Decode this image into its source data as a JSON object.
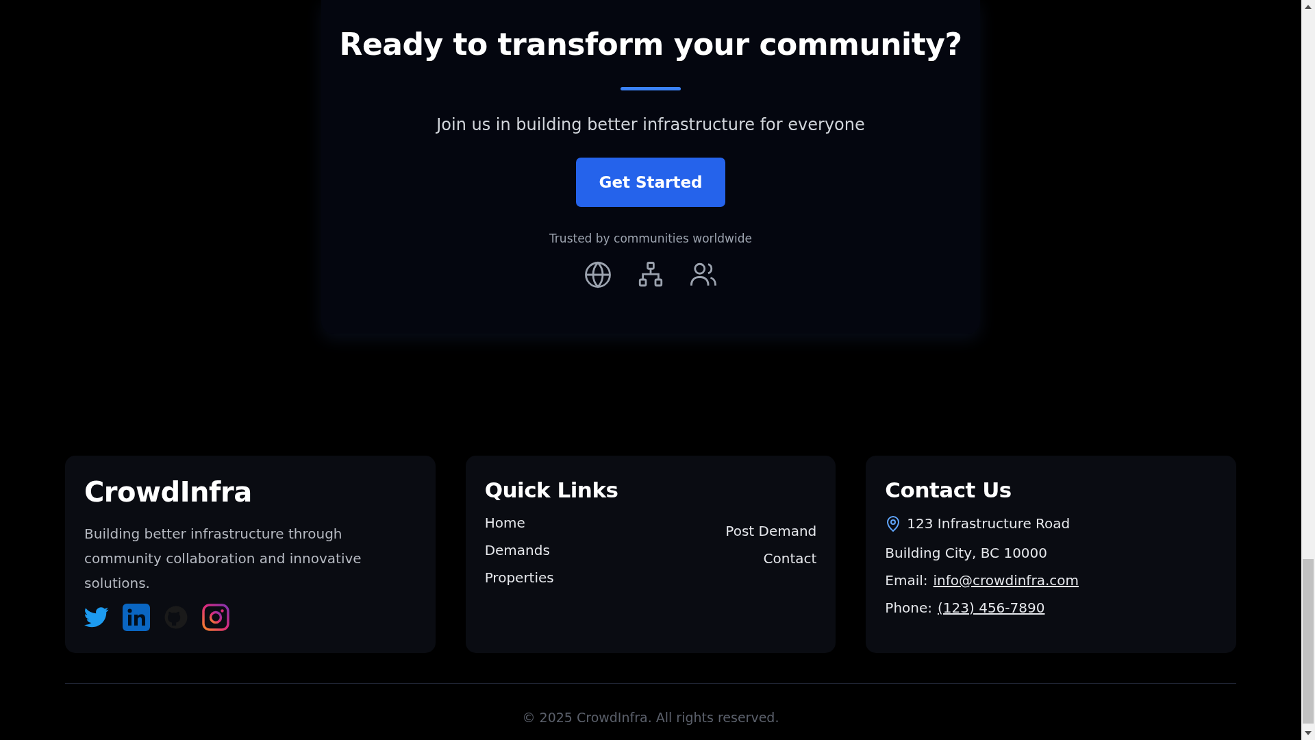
{
  "cta": {
    "title": "Ready to transform your community?",
    "subtitle": "Join us in building better infrastructure for everyone",
    "button": "Get Started",
    "trusted": "Trusted by communities worldwide"
  },
  "footer": {
    "brand": {
      "name": "CrowdInfra",
      "tagline": "Building better infrastructure through community collaboration and innovative solutions."
    },
    "quick_links": {
      "title": "Quick Links",
      "column_1": [
        "Home",
        "Demands",
        "Properties"
      ],
      "column_2": [
        "Post Demand",
        "Contact"
      ]
    },
    "contact": {
      "title": "Contact Us",
      "address_1": "123 Infrastructure Road",
      "address_2": "Building City, BC 10000",
      "email_label": "Email:",
      "email": "info@crowdinfra.com",
      "phone_label": "Phone:",
      "phone": "(123) 456-7890"
    },
    "copyright": "© 2025 CrowdInfra. All rights reserved."
  }
}
